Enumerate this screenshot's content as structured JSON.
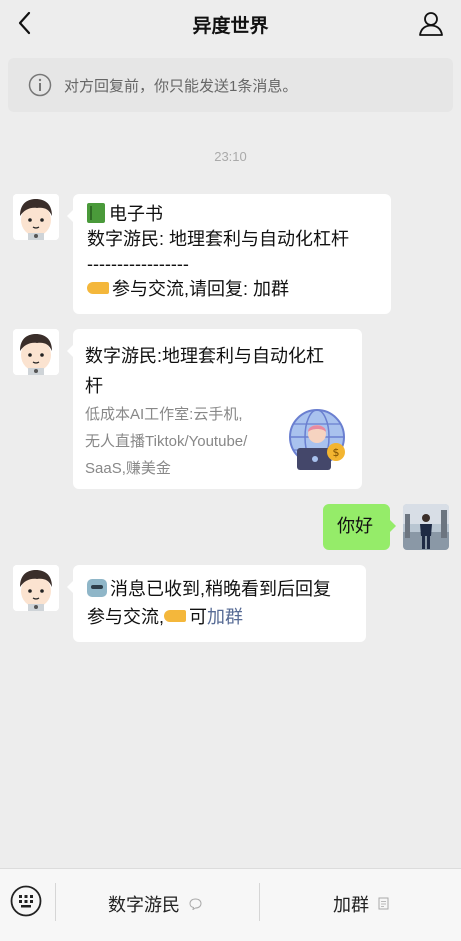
{
  "header": {
    "title": "异度世界",
    "back_icon": "chevron-left-icon",
    "profile_icon": "person-icon"
  },
  "notice": {
    "text": "对方回复前，你只能发送1条消息。",
    "icon": "info-icon"
  },
  "timestamp": "23:10",
  "messages": [
    {
      "from": "other",
      "lines": [
        "电子书",
        "数字游民: 地理套利与自动化杠杆",
        "-----------------",
        "参与交流,请回复:  加群"
      ]
    },
    {
      "from": "other",
      "type": "card",
      "title_lines": [
        "数字游民:地理套利与自动化杠",
        "杆"
      ],
      "desc_lines": [
        "低成本AI工作室:云手机,",
        "无人直播Tiktok/Youtube/",
        "SaaS,赚美金"
      ]
    },
    {
      "from": "me",
      "text": "你好"
    },
    {
      "from": "other",
      "line1": "消息已收到,稍晚看到后回复",
      "line2_prefix": "参与交流,",
      "line2_mid": "可",
      "line2_link": "加群"
    }
  ],
  "bottom": {
    "keyboard_icon": "keyboard-icon",
    "menu1": "数字游民",
    "menu2": "加群"
  },
  "colors": {
    "background": "#ededed",
    "my_bubble": "#95ec69",
    "link": "#576b95"
  }
}
